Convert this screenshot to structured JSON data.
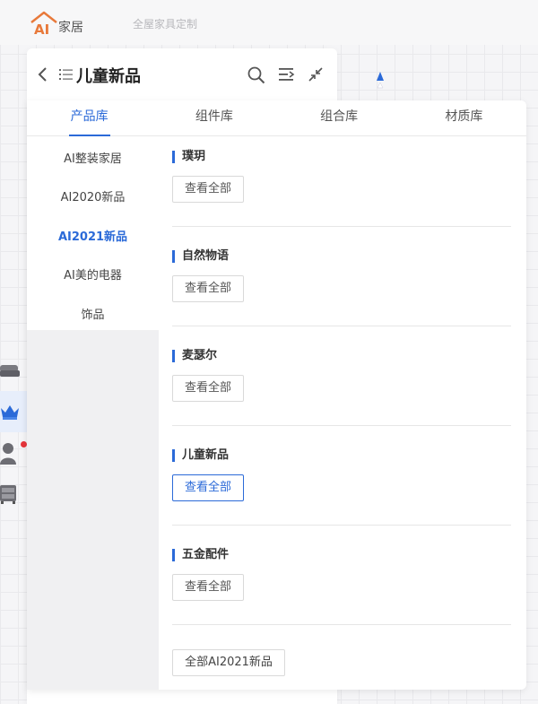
{
  "app": {
    "logo_text": "家居",
    "logo_mark": "AI",
    "tagline": "全屋家具定制"
  },
  "panel": {
    "title": "儿童新品"
  },
  "tabs": [
    {
      "label": "产品库"
    },
    {
      "label": "组件库"
    },
    {
      "label": "组合库"
    },
    {
      "label": "材质库"
    }
  ],
  "categories": [
    {
      "label": "AI整装家居"
    },
    {
      "label": "AI2020新品"
    },
    {
      "label": "AI2021新品"
    },
    {
      "label": "AI美的电器"
    },
    {
      "label": "饰品"
    }
  ],
  "sections": [
    {
      "title": "璞玥",
      "button": "查看全部"
    },
    {
      "title": "自然物语",
      "button": "查看全部"
    },
    {
      "title": "麦瑟尔",
      "button": "查看全部"
    },
    {
      "title": "儿童新品",
      "button": "查看全部"
    },
    {
      "title": "五金配件",
      "button": "查看全部"
    }
  ],
  "all_button": "全部AI2021新品",
  "colors": {
    "accent": "#2b6ad8",
    "logo_orange": "#e8793a",
    "badge_red": "#e8353b"
  },
  "icons": [
    "back-icon",
    "list-icon",
    "search-icon",
    "collapse-list-icon",
    "shrink-icon",
    "sofa-icon",
    "crown-icon",
    "user-icon",
    "cabinet-icon",
    "arrow-up-icon"
  ]
}
